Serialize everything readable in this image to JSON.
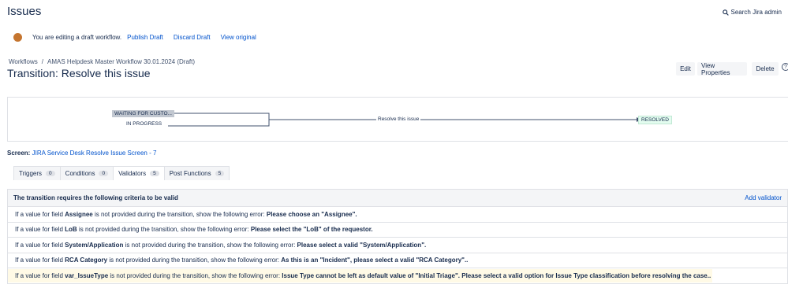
{
  "header": {
    "title": "Issues",
    "search_label": "Search Jira admin"
  },
  "draft_bar": {
    "message": "You are editing a draft workflow.",
    "publish": "Publish Draft",
    "discard": "Discard Draft",
    "view_original": "View original"
  },
  "breadcrumb": {
    "root": "Workflows",
    "sep": "/",
    "workflow": "AMAS Helpdesk Master Workflow 30.01.2024 (Draft)"
  },
  "transition_title": "Transition: Resolve this issue",
  "actions": {
    "edit": "Edit",
    "view_properties": "View Properties",
    "delete": "Delete",
    "help": "?"
  },
  "diagram": {
    "from_status_1": "WAITING FOR CUSTO...",
    "from_status_2": "IN PROGRESS",
    "transition": "Resolve this issue",
    "to_status": "RESOLVED"
  },
  "screen": {
    "label": "Screen:",
    "value": "JIRA Service Desk Resolve Issue Screen - 7"
  },
  "tabs": [
    {
      "label": "Triggers",
      "count": "0"
    },
    {
      "label": "Conditions",
      "count": "0"
    },
    {
      "label": "Validators",
      "count": "5"
    },
    {
      "label": "Post Functions",
      "count": "5"
    }
  ],
  "validators": {
    "header": "The transition requires the following criteria to be valid",
    "add": "Add validator",
    "prefix": "If a value for field",
    "middle": "is not provided during the transition, show the following error:",
    "rows": [
      {
        "field": "Assignee",
        "error": "Please choose an \"Assignee\"."
      },
      {
        "field": "LoB",
        "error": "Please select the \"LoB\" of the requestor."
      },
      {
        "field": "System/Application",
        "error": "Please select a valid \"System/Application\"."
      },
      {
        "field": "RCA Category",
        "error": "As this is an \"Incident\", please select a valid \"RCA Category\".."
      },
      {
        "field": "var_IssueType",
        "error": "Issue Type cannot be left as default value of \"Initial Triage\". Please select a valid option for Issue Type classification before resolving the case.."
      }
    ]
  },
  "colors": {
    "link": "#0052cc",
    "draft_dot": "#c5752f",
    "highlight": "#fffae6",
    "resolved_bg": "#e3fcef"
  }
}
